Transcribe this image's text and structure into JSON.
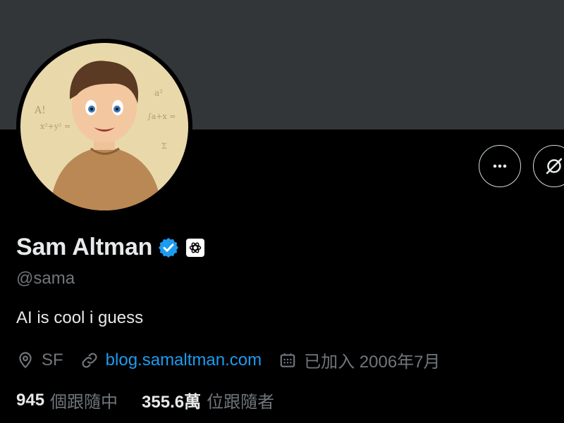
{
  "profile": {
    "display_name": "Sam Altman",
    "handle": "@sama",
    "bio": "AI is cool i guess",
    "location": "SF",
    "website": "blog.samaltman.com",
    "joined": "已加入 2006年7月"
  },
  "stats": {
    "following_count": "945",
    "following_label": "個跟隨中",
    "followers_count": "355.6萬",
    "followers_label": "位跟隨者"
  },
  "icons": {
    "verified": "verified-badge-icon",
    "org_badge": "openai-logo-icon",
    "location": "map-pin-icon",
    "website": "link-icon",
    "joined": "calendar-icon",
    "more": "more-dots-icon",
    "grok": "grok-icon"
  },
  "colors": {
    "background": "#000000",
    "banner": "#333639",
    "primary_text": "#e7e9ea",
    "secondary_text": "#71767b",
    "link": "#1d9bf0",
    "verified": "#1d9bf0"
  }
}
